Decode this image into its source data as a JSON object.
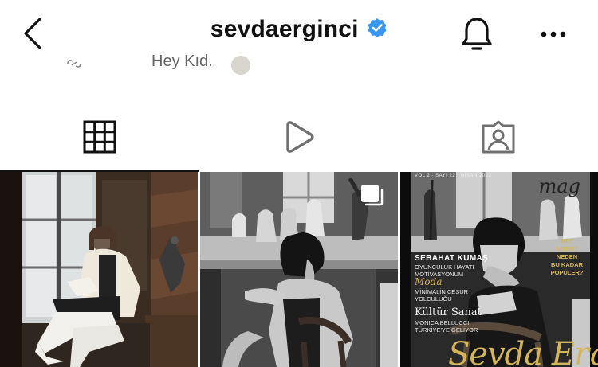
{
  "header": {
    "username": "sevdaerginci",
    "verified_badge": "verified-badge-icon",
    "back_icon": "chevron-left-icon",
    "bell_icon": "bell-icon",
    "more_icon": "more-horizontal-icon"
  },
  "peek": {
    "text": "Hey Kıd."
  },
  "tabs": [
    {
      "name": "posts",
      "icon": "grid-icon",
      "active": true
    },
    {
      "name": "reels",
      "icon": "play-icon",
      "active": false
    },
    {
      "name": "tagged",
      "icon": "tagged-person-icon",
      "active": false
    }
  ],
  "posts": [
    {
      "kind": "photo",
      "multi": false
    },
    {
      "kind": "photo",
      "multi": true,
      "multi_icon": "carousel-icon"
    },
    {
      "kind": "magazine-cover",
      "multi": false,
      "cover": {
        "mag": "mag",
        "vol": "VOL 2 · SAYI 22 · NİSAN 2022",
        "h1": "SEBAHAT KUMAŞ",
        "sub1_a": "OYUNCULUK HAYATI",
        "sub1_b": "MOTİVASYONUM",
        "h2": "Moda",
        "sub2_a": "MİNİMALİN CESUR",
        "sub2_b": "YOLCULUĞU",
        "h3": "Kültür Sanat",
        "sub3_a": "MONICA BELLUCCI",
        "sub3_b": "TÜRKİYE'YE GELİYOR",
        "side_a": "NFT NEDİR?",
        "side_b": "NEDEN",
        "side_c": "BU KADAR",
        "side_d": "POPÜLER?",
        "sign": "Sevda Erginci"
      }
    }
  ],
  "colors": {
    "verified_blue": "#3897f0",
    "gold": "#d5b55a",
    "text": "#111111"
  }
}
